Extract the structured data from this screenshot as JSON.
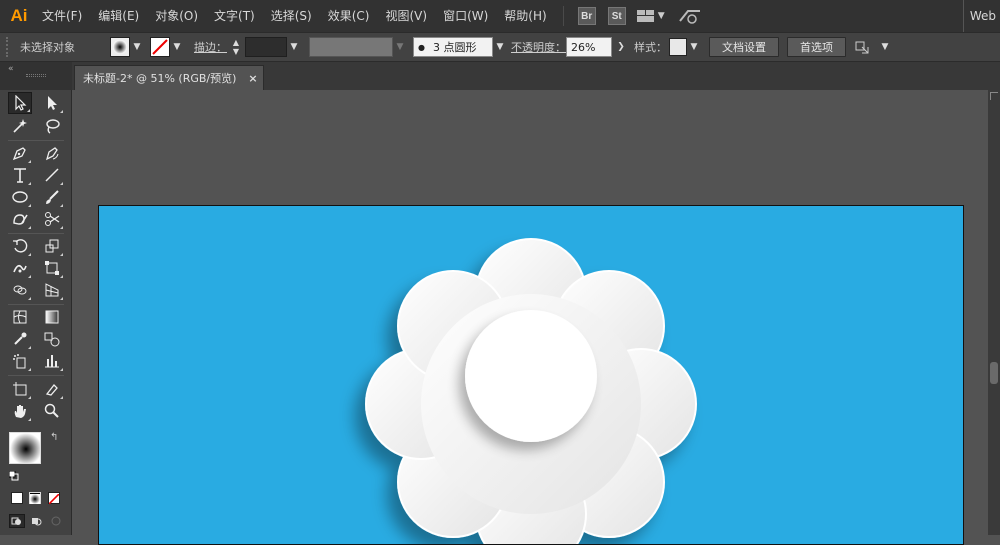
{
  "menubar": {
    "logo": "Ai",
    "items": [
      "文件(F)",
      "编辑(E)",
      "对象(O)",
      "文字(T)",
      "选择(S)",
      "效果(C)",
      "视图(V)",
      "窗口(W)",
      "帮助(H)"
    ],
    "bridge_label": "Br",
    "stock_label": "St",
    "workspace_label": "Web"
  },
  "control": {
    "selection_status": "未选择对象",
    "stroke_label": "描边：",
    "brush_value": "3 点圆形",
    "opacity_label": "不透明度：",
    "opacity_value": "26%",
    "style_label": "样式：",
    "doc_setup_label": "文档设置",
    "prefs_label": "首选项"
  },
  "document": {
    "tab_title": "未标题-2* @ 51% (RGB/预览)",
    "close_glyph": "×"
  },
  "colors": {
    "artboard_bg": "#29abe2",
    "flower": "#f2f2f2",
    "center": "#ffffff",
    "app_accent": "#ff9a00"
  }
}
